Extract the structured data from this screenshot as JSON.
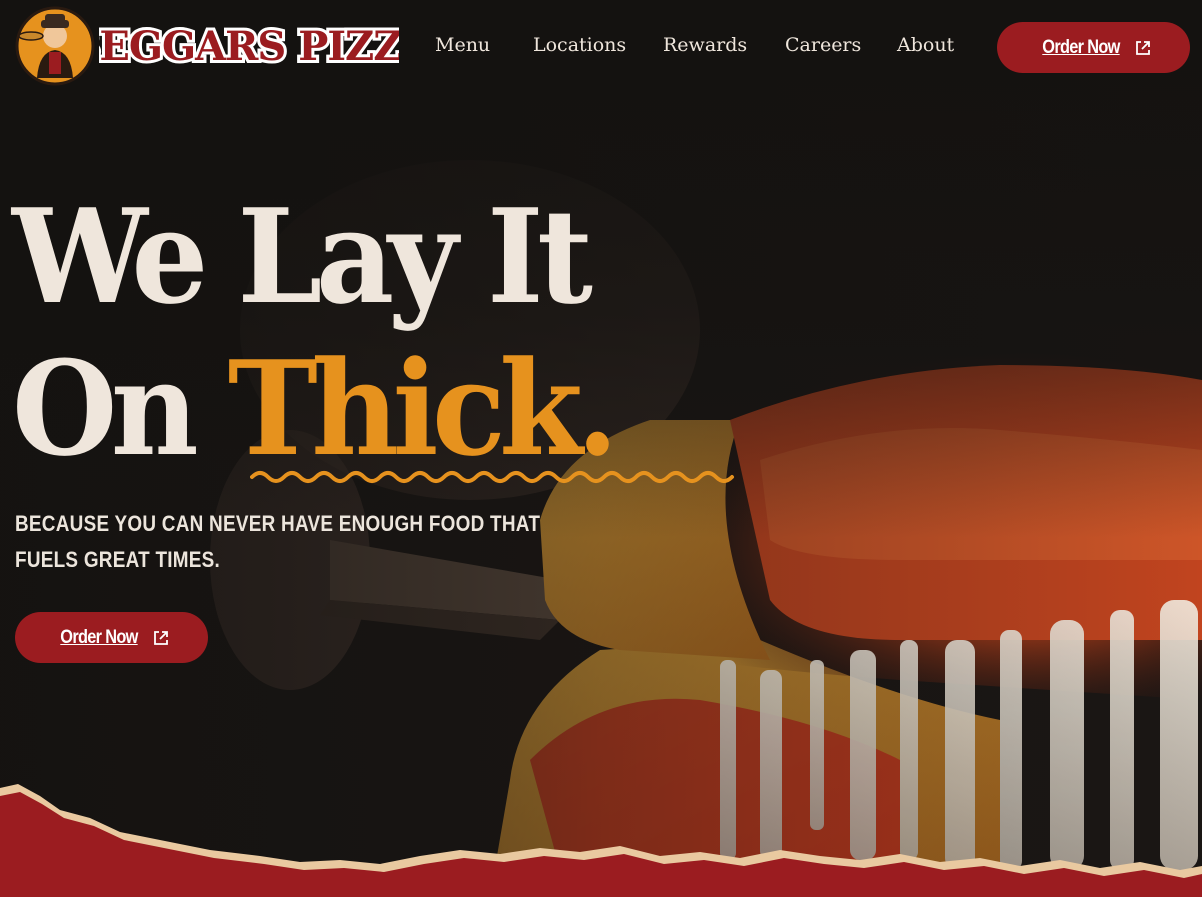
{
  "brand": {
    "name": "Beggars Pizza",
    "logo_icon": "mascot-badge-icon",
    "colors": {
      "primary_red": "#9b1c20",
      "accent_gold": "#e6921e",
      "cream": "#efe6dc",
      "dark": "#141210"
    }
  },
  "nav": {
    "items": [
      {
        "label": "Menu"
      },
      {
        "label": "Locations"
      },
      {
        "label": "Rewards"
      },
      {
        "label": "Careers"
      },
      {
        "label": "About"
      }
    ],
    "order_button": {
      "label": "Order Now",
      "icon": "external-link-icon"
    }
  },
  "hero": {
    "headline_line1": "We Lay It",
    "headline_line2_plain": "On ",
    "headline_line2_accent": "Thick.",
    "subhead_line1": "Because you can never have enough food that",
    "subhead_line2": "fuels great times.",
    "cta": {
      "label": "Order Now",
      "icon": "external-link-icon"
    }
  }
}
